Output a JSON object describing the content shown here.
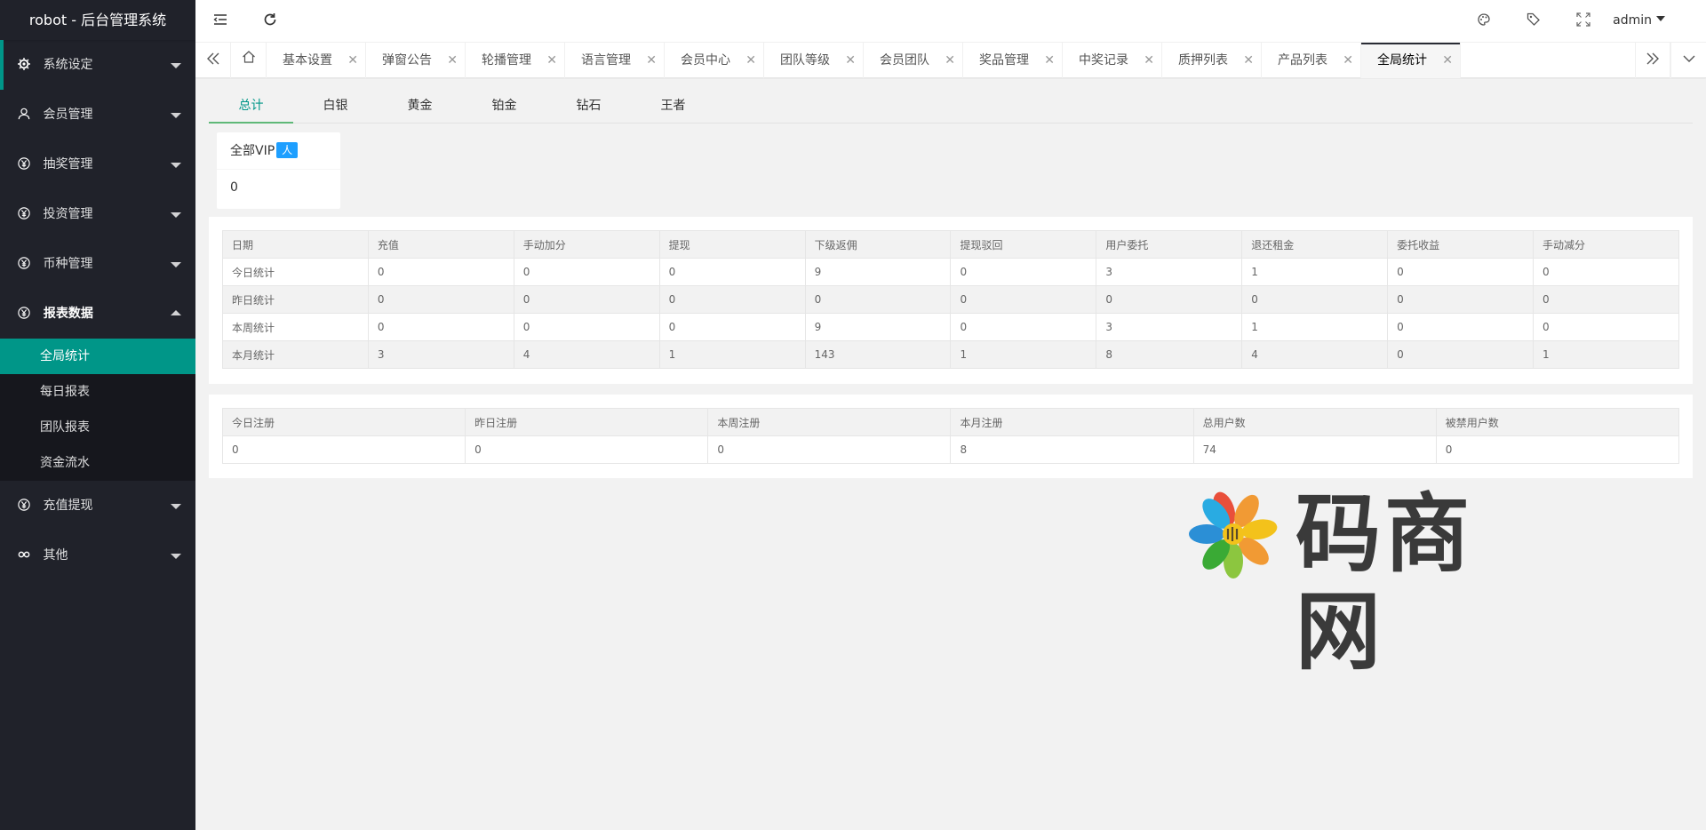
{
  "app": {
    "title": "robot - 后台管理系统"
  },
  "sidebar": {
    "items": [
      {
        "label": "系统设定",
        "icon": "gear-icon"
      },
      {
        "label": "会员管理",
        "icon": "user-icon"
      },
      {
        "label": "抽奖管理",
        "icon": "yen-icon"
      },
      {
        "label": "投资管理",
        "icon": "yen-icon"
      },
      {
        "label": "币种管理",
        "icon": "yen-icon"
      },
      {
        "label": "报表数据",
        "icon": "yen-icon"
      },
      {
        "label": "充值提现",
        "icon": "yen-icon"
      },
      {
        "label": "其他",
        "icon": "link-icon"
      }
    ],
    "report_sub": [
      "全局统计",
      "每日报表",
      "团队报表",
      "资金流水"
    ]
  },
  "header": {
    "user": "admin"
  },
  "tabs": [
    "基本设置",
    "弹窗公告",
    "轮播管理",
    "语言管理",
    "会员中心",
    "团队等级",
    "会员团队",
    "奖品管理",
    "中奖记录",
    "质押列表",
    "产品列表",
    "全局统计"
  ],
  "subtabs": [
    "总计",
    "白银",
    "黄金",
    "铂金",
    "钻石",
    "王者"
  ],
  "vip": {
    "label": "全部VIP",
    "badge": "人",
    "value": "0"
  },
  "stats_table": {
    "headers": [
      "日期",
      "充值",
      "手动加分",
      "提现",
      "下级返佣",
      "提现驳回",
      "用户委托",
      "退还租金",
      "委托收益",
      "手动减分"
    ],
    "rows": [
      [
        "今日统计",
        "0",
        "0",
        "0",
        "9",
        "0",
        "3",
        "1",
        "0",
        "0"
      ],
      [
        "昨日统计",
        "0",
        "0",
        "0",
        "0",
        "0",
        "0",
        "0",
        "0",
        "0"
      ],
      [
        "本周统计",
        "0",
        "0",
        "0",
        "9",
        "0",
        "3",
        "1",
        "0",
        "0"
      ],
      [
        "本月统计",
        "3",
        "4",
        "1",
        "143",
        "1",
        "8",
        "4",
        "0",
        "1"
      ]
    ]
  },
  "reg_table": {
    "headers": [
      "今日注册",
      "昨日注册",
      "本周注册",
      "本月注册",
      "总用户数",
      "被禁用户数"
    ],
    "rows": [
      [
        "0",
        "0",
        "0",
        "8",
        "74",
        "0"
      ]
    ]
  },
  "watermark": {
    "text": "码商网"
  },
  "colors": {
    "accent": "#009688",
    "sidebar": "#20222a",
    "badge": "#1E9FFF"
  }
}
